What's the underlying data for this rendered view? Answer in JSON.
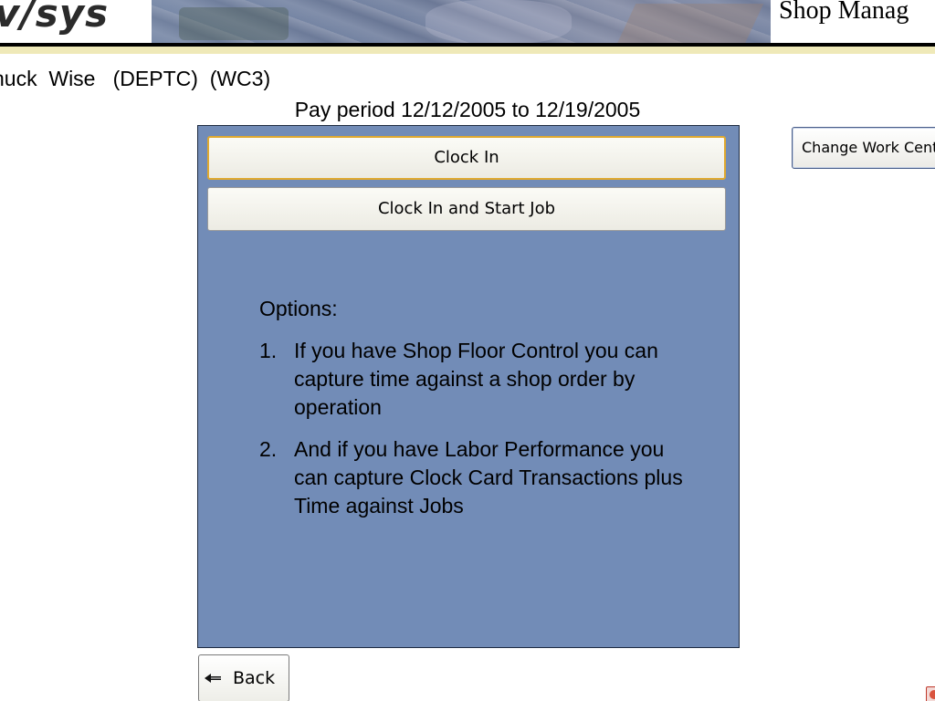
{
  "header": {
    "logo_text": "v/sys",
    "title": "Shop Manag"
  },
  "employee": {
    "line": "huck  Wise   (DEPTC)  (WC3)"
  },
  "pay_period": {
    "text": "Pay period 12/12/2005 to 12/19/2005"
  },
  "panel": {
    "clock_in_label": "Clock In",
    "clock_in_start_job_label": "Clock In and Start Job",
    "options_title": "Options:",
    "options": [
      {
        "num": "1.",
        "text": "If you have Shop Floor Control you can capture time against a shop order by operation"
      },
      {
        "num": "2.",
        "text": "And if you have Labor Performance you can capture Clock Card Transactions plus Time against Jobs"
      }
    ]
  },
  "side": {
    "change_work_center_label": "Change Work Cente"
  },
  "footer": {
    "back_label": "Back"
  },
  "icons": {
    "back": "back-arrow-icon",
    "close": "close-icon"
  },
  "colors": {
    "panel": "#728cb7",
    "focus_border": "#e0a92f",
    "header_rule": "#efe9b8"
  }
}
